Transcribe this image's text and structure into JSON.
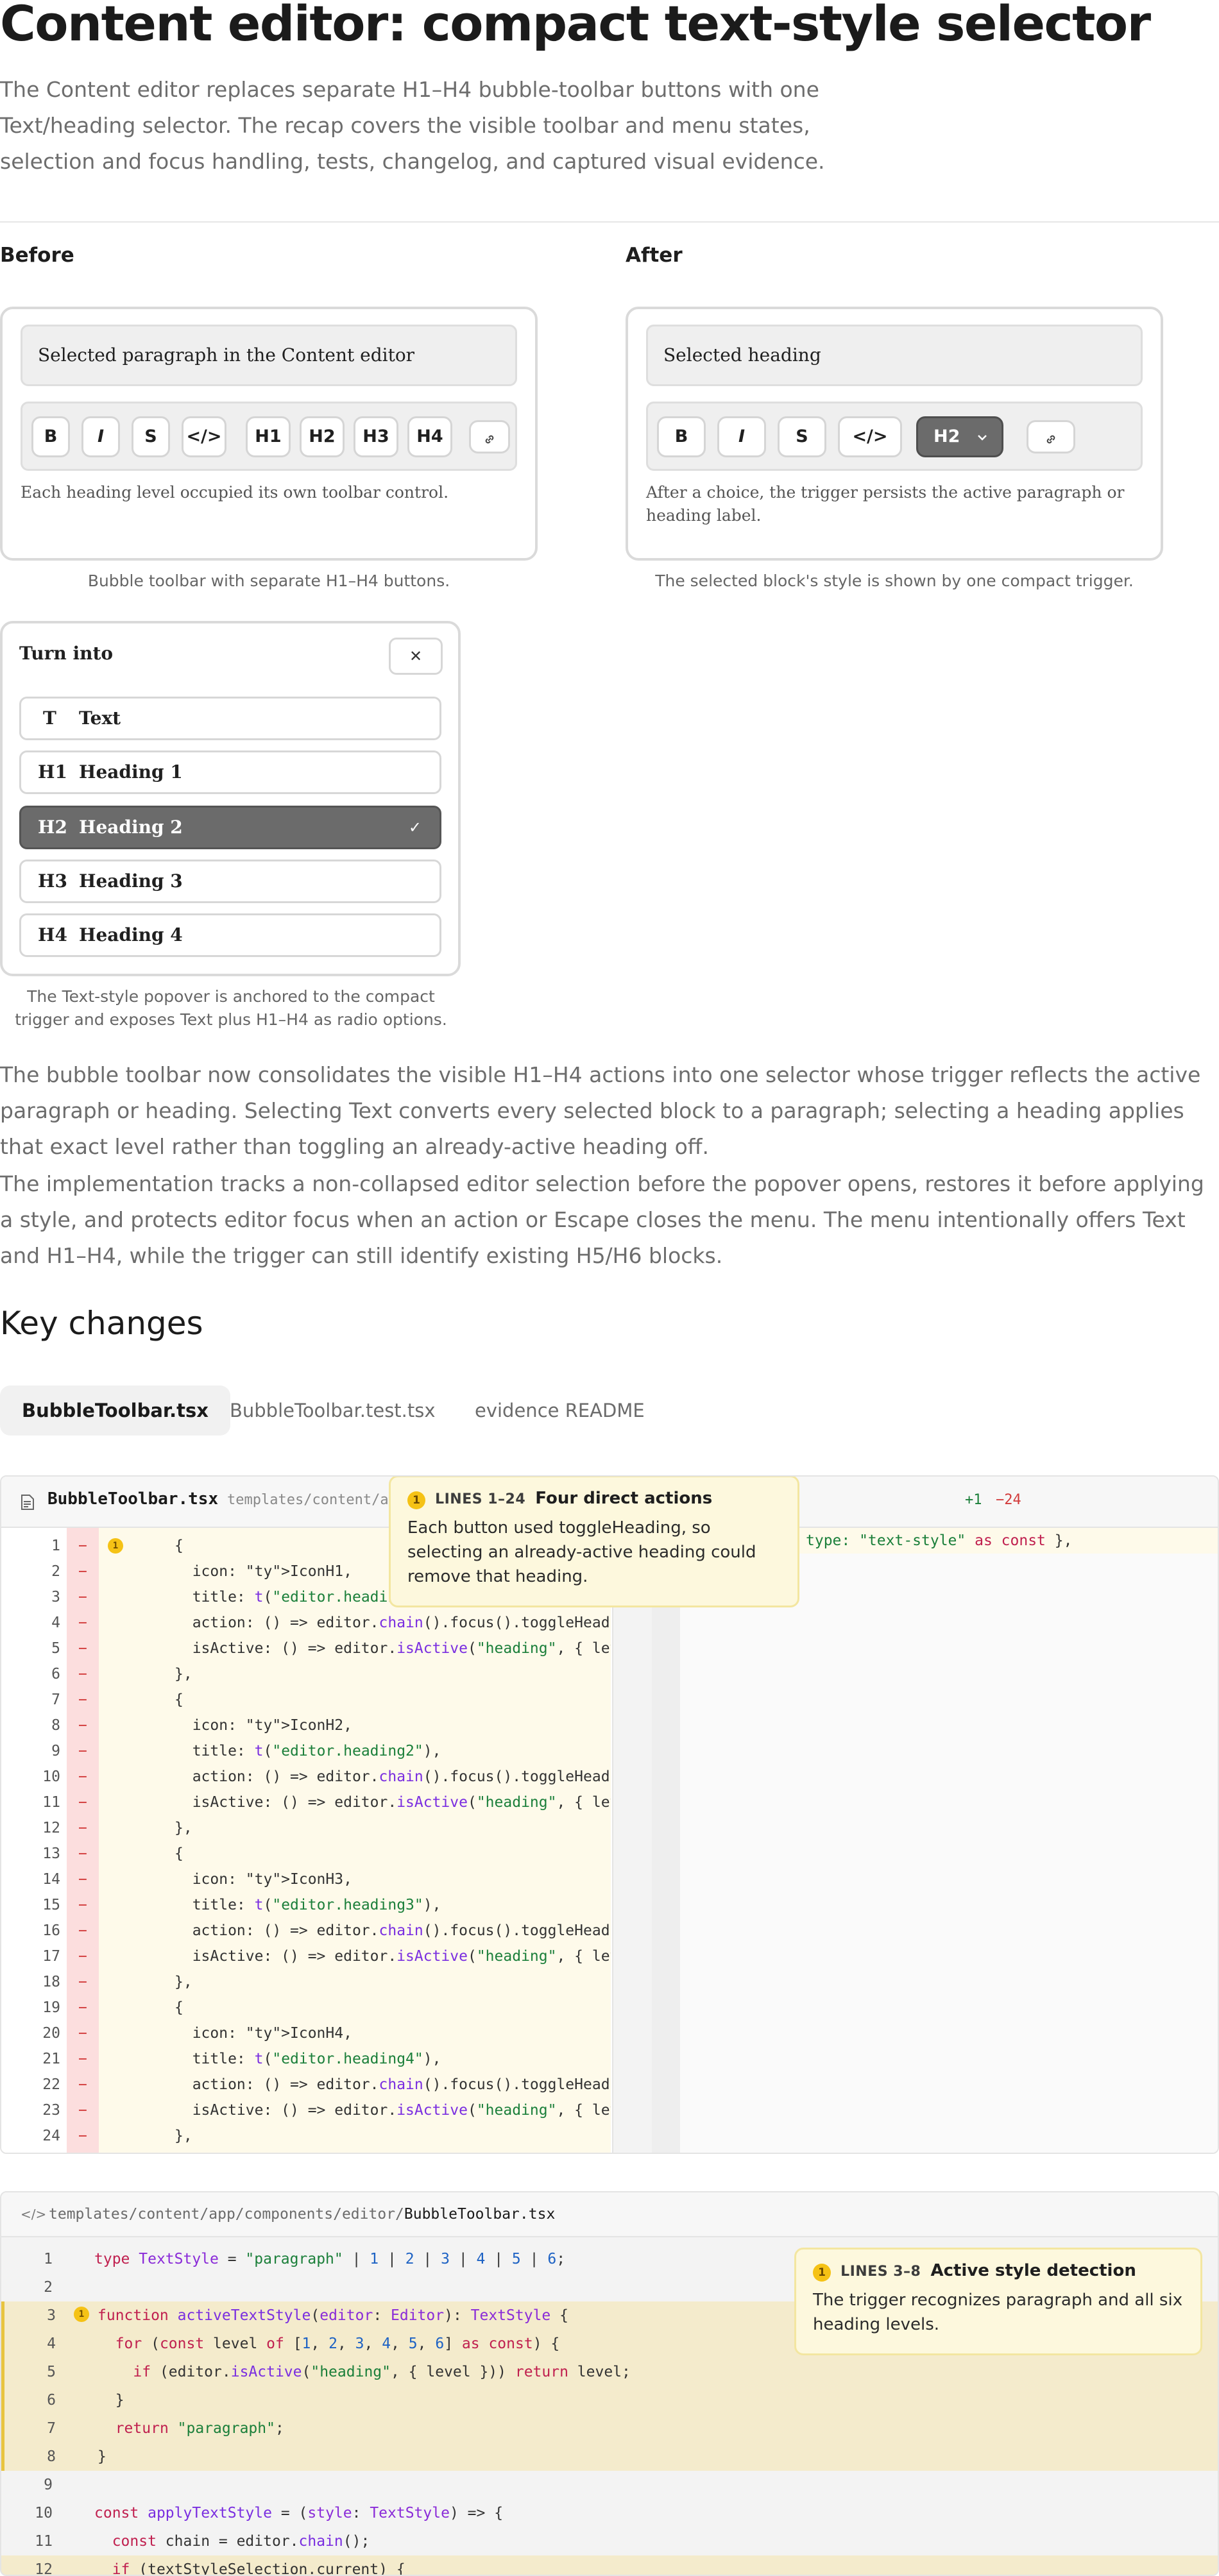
{
  "header": {
    "title": "Content editor: compact text-style selector",
    "intro": "The Content editor replaces separate H1–H4 bubble-toolbar buttons with one Text/heading selector. The recap covers the visible toolbar and menu states, selection and focus handling, tests, changelog, and captured visual evidence."
  },
  "before": {
    "label": "Before",
    "selection_text": "Selected paragraph in the Content editor",
    "buttons": [
      "B",
      "I",
      "S",
      "</>",
      "H1",
      "H2",
      "H3",
      "H4"
    ],
    "note": "Each heading level occupied its own toolbar control.",
    "caption": "Bubble toolbar with separate H1–H4 buttons."
  },
  "after": {
    "label": "After",
    "selection_text": "Selected heading",
    "buttons": [
      "B",
      "I",
      "S",
      "</>"
    ],
    "trigger_label": "H2",
    "note": "After a choice, the trigger persists the active paragraph or heading label.",
    "caption": "The selected block's style is shown by one compact trigger."
  },
  "menu": {
    "title": "Turn into",
    "close_glyph": "✕",
    "items": [
      {
        "icon": "T",
        "label": "Text",
        "selected": false
      },
      {
        "icon": "H1",
        "label": "Heading 1",
        "selected": false
      },
      {
        "icon": "H2",
        "label": "Heading 2",
        "selected": true
      },
      {
        "icon": "H3",
        "label": "Heading 3",
        "selected": false
      },
      {
        "icon": "H4",
        "label": "Heading 4",
        "selected": false
      }
    ],
    "check_glyph": "✓",
    "caption": "The Text-style popover is anchored to the compact trigger and exposes Text plus H1–H4 as radio options."
  },
  "paragraphs": [
    "The bubble toolbar now consolidates the visible H1–H4 actions into one selector whose trigger reflects the active paragraph or heading. Selecting Text converts every selected block to a paragraph; selecting a heading applies that exact level rather than toggling an already-active heading off.",
    "The implementation tracks a non-collapsed editor selection before the popover opens, restores it before applying a style, and protects editor focus when an action or Escape closes the menu. The menu intentionally offers Text and H1–H4, while the trigger can still identify existing H5/H6 blocks."
  ],
  "key_changes": {
    "title": "Key changes",
    "tabs": [
      "BubbleToolbar.tsx",
      "BubbleToolbar.test.tsx",
      "evidence README"
    ],
    "active_tab": 0
  },
  "diff": {
    "file_name": "BubbleToolbar.tsx",
    "file_path": "templates/content/a",
    "stats_added": "+1",
    "stats_removed": "−24",
    "right_line": "type: \"text-style\" as const },",
    "callout": {
      "badge": "1",
      "lines": "LINES 1–24",
      "title": "Four direct actions",
      "body": "Each button used toggleHeading, so selecting an already-active heading could remove that heading."
    },
    "lines": [
      "{",
      "  icon: IconH1,",
      "  title: t(\"editor.heading1\"),",
      "  action: () => editor.chain().focus().toggleHeading",
      "  isActive: () => editor.isActive(\"heading\", { level",
      "},",
      "{",
      "  icon: IconH2,",
      "  title: t(\"editor.heading2\"),",
      "  action: () => editor.chain().focus().toggleHeading",
      "  isActive: () => editor.isActive(\"heading\", { level",
      "},",
      "{",
      "  icon: IconH3,",
      "  title: t(\"editor.heading3\"),",
      "  action: () => editor.chain().focus().toggleHeading",
      "  isActive: () => editor.isActive(\"heading\", { level",
      "},",
      "{",
      "  icon: IconH4,",
      "  title: t(\"editor.heading4\"),",
      "  action: () => editor.chain().focus().toggleHeading",
      "  isActive: () => editor.isActive(\"heading\", { level",
      "},"
    ]
  },
  "code": {
    "path_prefix": "templates/content/app/components/editor/",
    "path_file": "BubbleToolbar.tsx",
    "callout": {
      "badge": "1",
      "lines": "LINES 3–8",
      "title": "Active style detection",
      "body": "The trigger recognizes paragraph and all six heading levels."
    }
  }
}
